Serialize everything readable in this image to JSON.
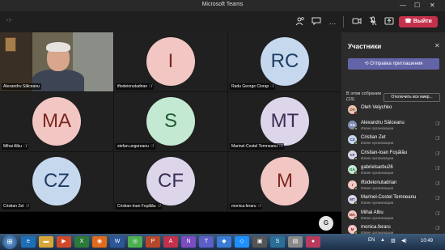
{
  "window": {
    "title": "Microsoft Teams",
    "minimize": "—",
    "maximize": "☐",
    "close": "✕"
  },
  "toolbar": {
    "timer": "-:-",
    "icons": [
      "people-icon",
      "chat-icon",
      "more-icon",
      "camera-icon",
      "mic-muted-icon",
      "share-icon"
    ],
    "leave_label": "Выйти",
    "leave_color": "#c4314b"
  },
  "tiles": [
    {
      "name": "Alexandru Sălceanu",
      "type": "video",
      "muted": false
    },
    {
      "name": "iftodeionutadrian",
      "initials": "I",
      "color": "pink",
      "muted": true
    },
    {
      "name": "Radu George Ciorap",
      "initials": "RC",
      "color": "blue",
      "muted": true
    },
    {
      "name": "Mihai Albu",
      "initials": "MA",
      "color": "pink",
      "muted": true
    },
    {
      "name": "stefan.ungureanu",
      "initials": "S",
      "color": "green",
      "muted": true
    },
    {
      "name": "Marinel-Costel Temneanu",
      "initials": "MT",
      "color": "lav",
      "muted": true
    },
    {
      "name": "Cristian Zet",
      "initials": "CZ",
      "color": "blue",
      "muted": true
    },
    {
      "name": "Cristian-Ioan Foşâlău",
      "initials": "CF",
      "color": "lav",
      "muted": true
    },
    {
      "name": "monica.feraru",
      "initials": "M",
      "color": "pink",
      "muted": true
    }
  ],
  "self_avatar": "G",
  "panel": {
    "title": "Участники",
    "invite_label": "Отправка приглашения",
    "section_label": "В этом собрании (13)",
    "mute_all_label": "Отключить все микр...",
    "participants": [
      {
        "name": "Oleh Velychko",
        "sub": "",
        "initials": "OV",
        "bg": "#e8c4b0",
        "fg": "#6b3a22",
        "dot": "#c4314b",
        "mic": false
      },
      {
        "name": "Alexandru Sălceanu",
        "sub": "Извне организации",
        "initials": "AS",
        "bg": "#7d8fb0",
        "fg": "#fff",
        "dot": "#92c353",
        "mic": true
      },
      {
        "name": "Cristian Zet",
        "sub": "Извне организации",
        "initials": "CZ",
        "bg": "#c5d8ee",
        "fg": "#1f3e63",
        "dot": "#92c353",
        "mic": true
      },
      {
        "name": "Cristian-Ioan Foşâlău",
        "sub": "Извне организации",
        "initials": "CF",
        "bg": "#ddd6ea",
        "fg": "#3a2f56",
        "dot": "#92c353",
        "mic": true
      },
      {
        "name": "gabrielsarbu26",
        "sub": "Извне организации",
        "initials": "GA",
        "bg": "#c4e9d2",
        "fg": "#1d5a34",
        "dot": "#92c353",
        "mic": true
      },
      {
        "name": "iftodeionutadrian",
        "sub": "Извне организации",
        "initials": "I",
        "bg": "#f2c6c3",
        "fg": "#7c2820",
        "dot": "#92c353",
        "mic": true
      },
      {
        "name": "Marinel-Costel Temneanu",
        "sub": "Извне организации",
        "initials": "MT",
        "bg": "#ddd6ea",
        "fg": "#3a2f56",
        "dot": "#92c353",
        "mic": true
      },
      {
        "name": "Mihai Albu",
        "sub": "Извне организации",
        "initials": "MA",
        "bg": "#f2c6c3",
        "fg": "#7c2820",
        "dot": "#92c353",
        "mic": true
      },
      {
        "name": "monica.feraru",
        "sub": "Извне организации",
        "initials": "M",
        "bg": "#f2c6c3",
        "fg": "#7c2820",
        "dot": "#92c353",
        "mic": true
      }
    ]
  },
  "taskbar": {
    "lang": "EN",
    "time": "10:49"
  }
}
